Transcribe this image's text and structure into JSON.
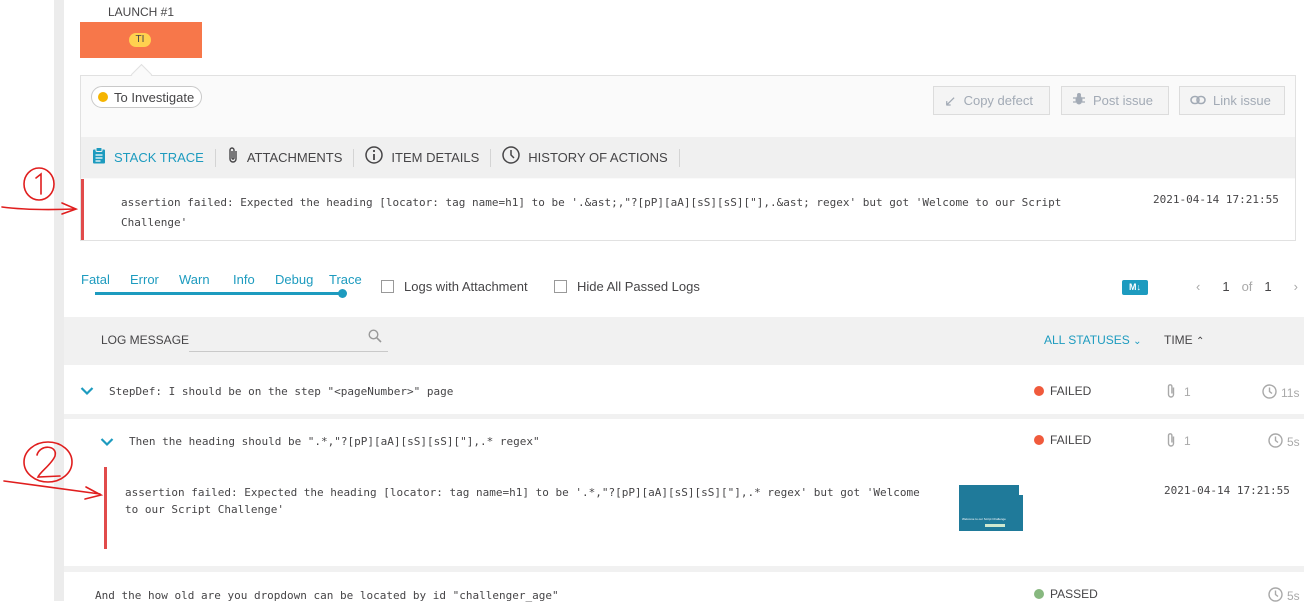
{
  "launch": {
    "label": "LAUNCH #1",
    "badge": "TI"
  },
  "defect": {
    "label": "To Investigate",
    "color": "#ffc000"
  },
  "actions": {
    "copy_defect": "Copy defect",
    "post_issue": "Post issue",
    "link_issue": "Link issue"
  },
  "tabs": [
    {
      "label": "STACK TRACE",
      "icon": "clipboard-icon"
    },
    {
      "label": "ATTACHMENTS",
      "icon": "paperclip-icon"
    },
    {
      "label": "ITEM DETAILS",
      "icon": "info-icon"
    },
    {
      "label": "HISTORY OF ACTIONS",
      "icon": "clock-icon"
    }
  ],
  "stack_trace": {
    "message": "assertion failed: Expected the heading [locator: tag name=h1] to be '.&ast;,\"?[pP][aA][sS][sS][\"],.&ast; regex' but got 'Welcome to our Script Challenge'",
    "time": "2021-04-14 17:21:55"
  },
  "log_levels": [
    "Fatal",
    "Error",
    "Warn",
    "Info",
    "Debug",
    "Trace"
  ],
  "filters": {
    "logs_with_attachment": "Logs with Attachment",
    "hide_passed": "Hide All Passed Logs"
  },
  "markdown_badge": "M↓",
  "pager": {
    "current": "1",
    "of": "of",
    "total": "1"
  },
  "log_table": {
    "message_header": "LOG MESSAGE",
    "status_header": "ALL STATUSES",
    "time_header": "TIME"
  },
  "rows": [
    {
      "text": "StepDef: I should be on the step \"<pageNumber>\" page",
      "status": "FAILED",
      "attachments": "1",
      "duration": "11s"
    },
    {
      "text": "Then the heading should be \".*,\"?[pP][aA][sS][sS][\"],.* regex\"",
      "status": "FAILED",
      "attachments": "1",
      "duration": "5s"
    },
    {
      "text": "And the how old are you dropdown can be located by id \"challenger_age\"",
      "status": "PASSED",
      "duration": "5s"
    }
  ],
  "nested_log": {
    "message": "assertion failed: Expected the heading [locator: tag name=h1] to be '.*,\"?[pP][aA][sS][sS][\"],.* regex' but got 'Welcome to our Script Challenge'",
    "time": "2021-04-14 17:21:55",
    "thumbnail_caption": "Welcome to our Script Challenge"
  },
  "colors": {
    "accent": "#1d9bbf",
    "failed": "#f05a3c",
    "passed": "#87b87f",
    "launch": "#f7774a",
    "annotation": "#e01e1e"
  }
}
